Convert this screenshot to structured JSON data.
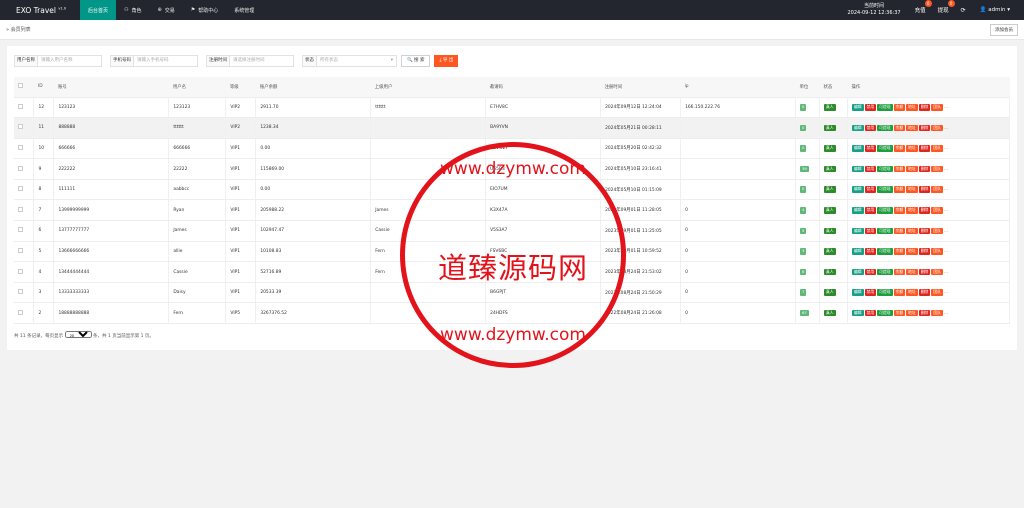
{
  "app": {
    "title": "EXO Travel",
    "version": "v1.0"
  },
  "nav": [
    {
      "label": "后台首页",
      "icon": ""
    },
    {
      "label": "角色",
      "icon": "person-icon"
    },
    {
      "label": "交易",
      "icon": "globe-icon"
    },
    {
      "label": "帮助中心",
      "icon": "flag-icon"
    },
    {
      "label": "系统管理",
      "icon": ""
    }
  ],
  "header": {
    "time_label": "当前时间",
    "time_value": "2024-09-12 12:36:37",
    "recharge_label": "充值",
    "recharge_badge": "0",
    "withdraw_label": "提现",
    "withdraw_badge": "0",
    "user": "admin"
  },
  "tabbar": {
    "breadcrumb": "会员列表",
    "logout": "添加会员"
  },
  "filters": {
    "username_label": "用户名称",
    "username_placeholder": "请输入用户名称",
    "phone_label": "手机号码",
    "phone_placeholder": "请输入手机号码",
    "regtime_label": "注册时间",
    "regtime_placeholder": "请选择注册时间",
    "status_label": "状态",
    "status_placeholder": "所有状态",
    "search_label": "搜 索",
    "export_label": "导 出"
  },
  "table": {
    "headers": [
      "ID",
      "账号",
      "用户名",
      "等级",
      "账户余额",
      "上级用户",
      "邀请码",
      "注册时间",
      "ip",
      "单位",
      "状态",
      "操作"
    ],
    "rows": [
      [
        "12",
        "123123",
        "123123",
        "VIP2",
        "2911.70",
        "tttttt",
        "E7HV8C",
        "2024年09月12日 12:24:04",
        "166.150.222.76",
        "0",
        "真人"
      ],
      [
        "11",
        "888888",
        "tttttt",
        "VIP2",
        "1238.34",
        "",
        "BA9YVN",
        "2024年05月21日 00:28:11",
        "",
        "0",
        "真人"
      ],
      [
        "10",
        "666666",
        "666666",
        "VIP1",
        "0.00",
        "",
        "ABVG2T",
        "2024年05月20日 02:42:32",
        "",
        "0",
        "真人"
      ],
      [
        "9",
        "222222",
        "22222",
        "VIP1",
        "115869.00",
        "",
        "U55B3",
        "2024年05月10日 23:16:41",
        "",
        "39",
        "真人"
      ],
      [
        "8",
        "111111",
        "aabbcc",
        "VIP1",
        "0.00",
        "",
        "EIO7UM",
        "2024年05月10日 01:15:09",
        "",
        "0",
        "真人"
      ],
      [
        "7",
        "13999999999",
        "Ryan",
        "VIP1",
        "205988.22",
        "James",
        "K3X47A",
        "2023年09月01日 11:28:05",
        "0",
        "4",
        "真人"
      ],
      [
        "6",
        "13777777777",
        "James",
        "VIP1",
        "102947.47",
        "Cassie",
        "V5S3A7",
        "2023年09月01日 11:25:05",
        "0",
        "5",
        "真人"
      ],
      [
        "5",
        "13666666666",
        "allie",
        "VIP1",
        "10108.83",
        "Fern",
        "FSV6BC",
        "2023年09月01日 10:59:52",
        "0",
        "3",
        "真人"
      ],
      [
        "4",
        "13444444444",
        "Cassie",
        "VIP1",
        "52716.89",
        "Fern",
        "",
        "2023年08月24日 21:53:02",
        "0",
        "6",
        "真人"
      ],
      [
        "3",
        "13333333333",
        "Daisy",
        "VIP1",
        "20533.39",
        "",
        "B6GPJT",
        "2022年08月24日 21:50:29",
        "0",
        "7",
        "真人"
      ],
      [
        "2",
        "18888888888",
        "Fern",
        "VIP5",
        "3267376.52",
        "",
        "24HDFS",
        "2022年08月24日 21:26:08",
        "0",
        "67",
        "真人"
      ]
    ],
    "actions": [
      "编辑",
      "禁用",
      "可提现",
      "余额",
      "地址",
      "删除",
      "团队",
      "..."
    ]
  },
  "pager": {
    "prefix": "共 11 条记录，每页显示",
    "page_size": "20",
    "suffix": "条，共 1 页当前显示第 1 页。"
  },
  "watermark": {
    "text": "道臻源码网",
    "url_top": "www.dzymw.com",
    "url_bottom": "www.dzymw.com"
  }
}
